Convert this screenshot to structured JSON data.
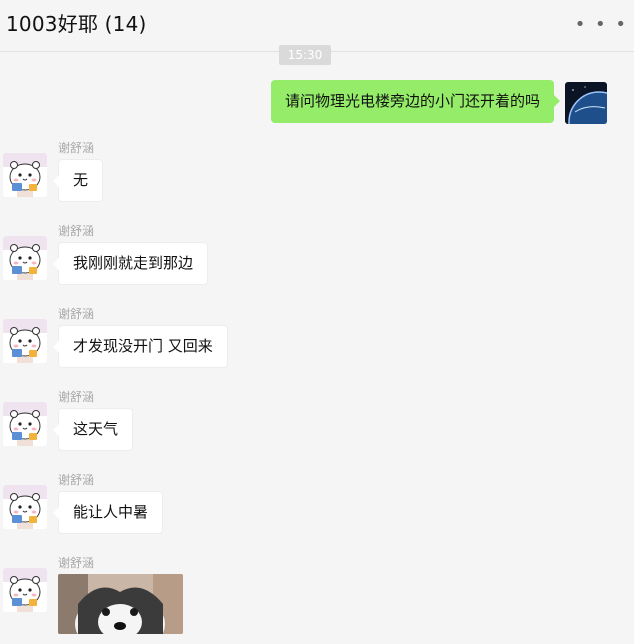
{
  "header": {
    "title": "1003好耶 (14)",
    "more_icon": "more-icon"
  },
  "chat": {
    "timestamp": "15:30",
    "outgoing": {
      "text": "请问物理光电楼旁边的小门还开着的吗",
      "avatar_icon": "earth-avatar"
    },
    "messages": [
      {
        "sender": "谢舒涵",
        "text": "无"
      },
      {
        "sender": "谢舒涵",
        "text": "我刚刚就走到那边"
      },
      {
        "sender": "谢舒涵",
        "text": "才发现没开门 又回来"
      },
      {
        "sender": "谢舒涵",
        "text": "这天气"
      },
      {
        "sender": "谢舒涵",
        "text": "能让人中暑"
      },
      {
        "sender": "谢舒涵",
        "image": "husky-photo"
      }
    ]
  },
  "colors": {
    "outgoing_bubble": "#95ec69",
    "incoming_bubble": "#ffffff",
    "background": "#f5f5f5"
  }
}
